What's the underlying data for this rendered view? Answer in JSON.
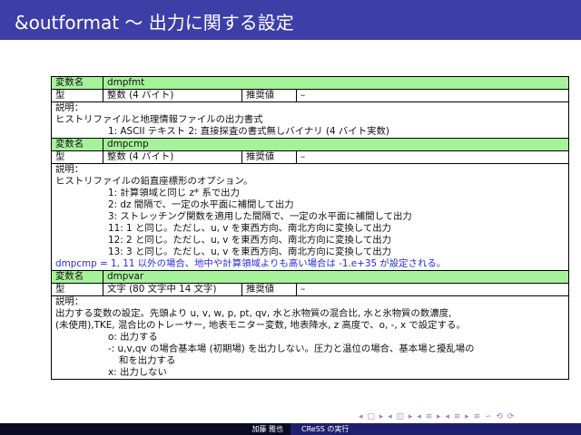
{
  "header": {
    "title": "&outformat ～ 出力に関する設定"
  },
  "labels": {
    "varname": "変数名",
    "type": "型",
    "recommended": "推奨値",
    "desc": "説明："
  },
  "params": [
    {
      "name": "dmpfmt",
      "type": "整数 (4 バイト)",
      "recommended": "–",
      "lines": [
        {
          "text": "ヒストリファイルと地理情報ファイルの出力書式",
          "style": "plain"
        },
        {
          "text": "1: ASCII テキスト 2: 直接探査の書式無しバイナリ (4 バイト実数)",
          "style": "indent"
        }
      ]
    },
    {
      "name": "dmpcmp",
      "type": "整数 (4 バイト)",
      "recommended": "–",
      "lines": [
        {
          "text": "ヒストリファイルの鉛直座標形のオプション。",
          "style": "plain"
        },
        {
          "text": "1: 計算領域と同じ z* 系で出力",
          "style": "indent"
        },
        {
          "text": "2: dz 間隔で、一定の水平面に補間して出力",
          "style": "indent"
        },
        {
          "text": "3: ストレッチング関数を適用した間隔で、一定の水平面に補間して出力",
          "style": "indent"
        },
        {
          "text": "11: 1 と同じ。ただし、u, v を東西方向、南北方向に変換して出力",
          "style": "indent"
        },
        {
          "text": "12: 2 と同じ。ただし、u, v を東西方向、南北方向に変換して出力",
          "style": "indent"
        },
        {
          "text": "13: 3 と同じ。ただし、u, v を東西方向、南北方向に変換して出力",
          "style": "indent"
        },
        {
          "text": "dmpcmp = 1, 11 以外の場合、地中や計算領域よりも高い場合は -1.e+35 が設定される。",
          "style": "blue"
        }
      ]
    },
    {
      "name": "dmpvar",
      "type": "文字 (80 文字中 14 文字)",
      "recommended": "–",
      "lines": [
        {
          "text": "出力する変数の設定。先頭より u, v, w, p, pt, qv, 水と氷物質の混合比, 水と氷物質の数濃度,",
          "style": "plain"
        },
        {
          "text": "(未使用),TKE, 混合比のトレーサー, 地表モニター変数, 地表降水, z 高度で、o, -, x で設定する。",
          "style": "plain"
        },
        {
          "text": "o: 出力する",
          "style": "indent"
        },
        {
          "text": "-: u,v,qv の場合基本場 (初期場) を出力しない。圧力と温位の場合、基本場と擾乱場の",
          "style": "indent"
        },
        {
          "text": "和を出力する",
          "style": "indent2"
        },
        {
          "text": "x: 出力しない",
          "style": "indent"
        }
      ]
    }
  ],
  "nav": {
    "symbols": "◂ ▢ ▸ ◂ ◫ ▸ ◂ ≡ ▸ ◂ ≡ ▸ ≡ ∽ ⟲ ⟳"
  },
  "footer": {
    "author": "加藤 雅也",
    "title": "CReSS の実行"
  }
}
